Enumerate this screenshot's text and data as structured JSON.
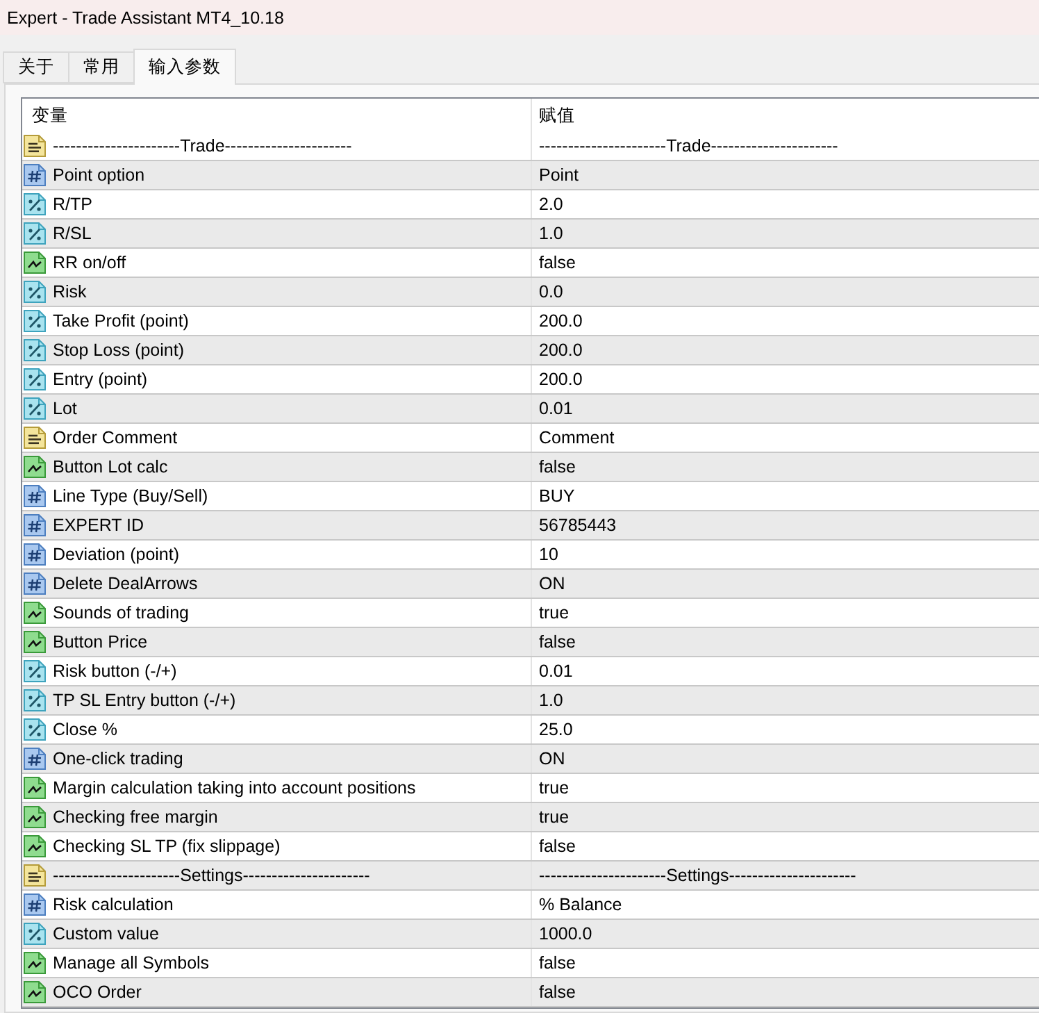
{
  "window": {
    "title": "Expert - Trade Assistant MT4_10.18"
  },
  "tabs": [
    {
      "label": "关于",
      "selected": false
    },
    {
      "label": "常用",
      "selected": false
    },
    {
      "label": "输入参数",
      "selected": true
    }
  ],
  "table": {
    "columns": [
      "变量",
      "赋值"
    ],
    "rows": [
      {
        "kind": "string",
        "variable": "----------------------Trade----------------------",
        "value": "----------------------Trade----------------------"
      },
      {
        "kind": "integer",
        "variable": "Point option",
        "value": "Point"
      },
      {
        "kind": "double",
        "variable": "R/TP",
        "value": "2.0"
      },
      {
        "kind": "double",
        "variable": "R/SL",
        "value": "1.0"
      },
      {
        "kind": "boolean",
        "variable": "RR on/off",
        "value": "false"
      },
      {
        "kind": "double",
        "variable": "Risk",
        "value": "0.0"
      },
      {
        "kind": "double",
        "variable": "Take Profit (point)",
        "value": "200.0"
      },
      {
        "kind": "double",
        "variable": "Stop Loss (point)",
        "value": "200.0"
      },
      {
        "kind": "double",
        "variable": "Entry (point)",
        "value": "200.0"
      },
      {
        "kind": "double",
        "variable": "Lot",
        "value": "0.01"
      },
      {
        "kind": "string",
        "variable": "Order Comment",
        "value": "Comment"
      },
      {
        "kind": "boolean",
        "variable": "Button Lot calc",
        "value": "false"
      },
      {
        "kind": "integer",
        "variable": "Line Type (Buy/Sell)",
        "value": "BUY"
      },
      {
        "kind": "integer",
        "variable": "EXPERT ID",
        "value": "56785443"
      },
      {
        "kind": "integer",
        "variable": "Deviation (point)",
        "value": "10"
      },
      {
        "kind": "integer",
        "variable": "Delete DealArrows",
        "value": "ON"
      },
      {
        "kind": "boolean",
        "variable": "Sounds of trading",
        "value": "true"
      },
      {
        "kind": "boolean",
        "variable": "Button Price",
        "value": "false"
      },
      {
        "kind": "double",
        "variable": "Risk button (-/+)",
        "value": "0.01"
      },
      {
        "kind": "double",
        "variable": "TP SL Entry button (-/+)",
        "value": "1.0"
      },
      {
        "kind": "double",
        "variable": "Close %",
        "value": "25.0"
      },
      {
        "kind": "integer",
        "variable": "One-click trading",
        "value": "ON"
      },
      {
        "kind": "boolean",
        "variable": "Margin calculation taking into account positions",
        "value": "true"
      },
      {
        "kind": "boolean",
        "variable": "Checking free margin",
        "value": "true"
      },
      {
        "kind": "boolean",
        "variable": "Checking SL TP (fix slippage)",
        "value": "false"
      },
      {
        "kind": "string",
        "variable": "----------------------Settings----------------------",
        "value": "----------------------Settings----------------------"
      },
      {
        "kind": "integer",
        "variable": "Risk calculation",
        "value": "% Balance"
      },
      {
        "kind": "double",
        "variable": "Custom value",
        "value": "1000.0"
      },
      {
        "kind": "boolean",
        "variable": "Manage all Symbols",
        "value": "false"
      },
      {
        "kind": "boolean",
        "variable": "OCO Order",
        "value": "false"
      }
    ]
  }
}
